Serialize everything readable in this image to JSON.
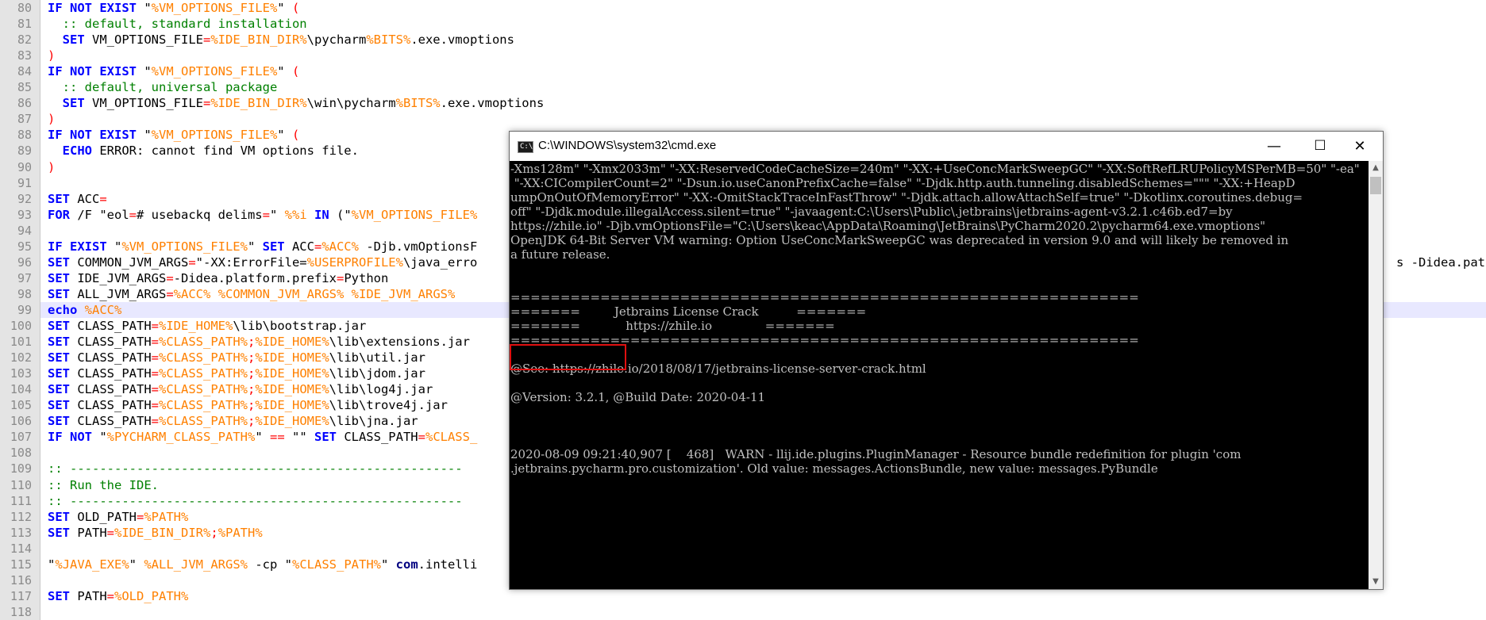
{
  "editor": {
    "line_numbers": [
      "80",
      "81",
      "82",
      "83",
      "84",
      "85",
      "86",
      "87",
      "88",
      "89",
      "90",
      "91",
      "92",
      "93",
      "94",
      "95",
      "96",
      "97",
      "98",
      "99",
      "100",
      "101",
      "102",
      "103",
      "104",
      "105",
      "106",
      "107",
      "108",
      "109",
      "110",
      "111",
      "112",
      "113",
      "114",
      "115",
      "116",
      "117",
      "118"
    ],
    "lines": {
      "l80": [
        "IF NOT EXIST",
        " \"",
        "%VM_OPTIONS_FILE%",
        "\" ",
        "("
      ],
      "l81": "  :: default, standard installation",
      "l82": [
        "  ",
        "SET",
        " VM_OPTIONS_FILE",
        "=",
        "%IDE_BIN_DIR%",
        "\\pycharm",
        "%BITS%",
        ".exe.vmoptions"
      ],
      "l83": ")",
      "l84": [
        "IF NOT EXIST",
        " \"",
        "%VM_OPTIONS_FILE%",
        "\" ",
        "("
      ],
      "l85": "  :: default, universal package",
      "l86": [
        "  ",
        "SET",
        " VM_OPTIONS_FILE",
        "=",
        "%IDE_BIN_DIR%",
        "\\win\\pycharm",
        "%BITS%",
        ".exe.vmoptions"
      ],
      "l87": ")",
      "l88": [
        "IF NOT EXIST",
        " \"",
        "%VM_OPTIONS_FILE%",
        "\" ",
        "("
      ],
      "l89": [
        "  ",
        "ECHO",
        " ERROR: cannot find VM options file."
      ],
      "l90": ")",
      "l92": [
        "SET",
        " ACC",
        "="
      ],
      "l93": [
        "FOR",
        " /F \"eol",
        "=",
        "# usebackq delims",
        "=",
        "\" ",
        "%%i",
        " ",
        "IN",
        " (\"",
        "%VM_OPTIONS_FILE%"
      ],
      "l95": [
        "IF EXIST",
        " \"",
        "%VM_OPTIONS_FILE%",
        "\" ",
        "SET",
        " ACC",
        "=",
        "%ACC%",
        " -Djb.vmOptionsF"
      ],
      "l96": [
        "SET",
        " COMMON_JVM_ARGS",
        "=",
        "\"-XX:ErrorFile=",
        "%USERPROFILE%",
        "\\java_erro"
      ],
      "l96_right": "s -Didea.paths",
      "l97": [
        "SET",
        " IDE_JVM_ARGS",
        "=",
        "-Didea.platform.prefix",
        "=",
        "Python"
      ],
      "l98": [
        "SET",
        " ALL_JVM_ARGS",
        "=",
        "%ACC%",
        " ",
        "%COMMON_JVM_ARGS%",
        " ",
        "%IDE_JVM_ARGS%"
      ],
      "l99": [
        "echo",
        " ",
        "%ACC%"
      ],
      "l100": [
        "SET",
        " CLASS_PATH",
        "=",
        "%IDE_HOME%",
        "\\lib\\bootstrap.jar"
      ],
      "l101": [
        "SET",
        " CLASS_PATH",
        "=",
        "%CLASS_PATH%",
        ";",
        "%IDE_HOME%",
        "\\lib\\extensions.jar"
      ],
      "l102": [
        "SET",
        " CLASS_PATH",
        "=",
        "%CLASS_PATH%",
        ";",
        "%IDE_HOME%",
        "\\lib\\util.jar"
      ],
      "l103": [
        "SET",
        " CLASS_PATH",
        "=",
        "%CLASS_PATH%",
        ";",
        "%IDE_HOME%",
        "\\lib\\jdom.jar"
      ],
      "l104": [
        "SET",
        " CLASS_PATH",
        "=",
        "%CLASS_PATH%",
        ";",
        "%IDE_HOME%",
        "\\lib\\log4j.jar"
      ],
      "l105": [
        "SET",
        " CLASS_PATH",
        "=",
        "%CLASS_PATH%",
        ";",
        "%IDE_HOME%",
        "\\lib\\trove4j.jar"
      ],
      "l106": [
        "SET",
        " CLASS_PATH",
        "=",
        "%CLASS_PATH%",
        ";",
        "%IDE_HOME%",
        "\\lib\\jna.jar"
      ],
      "l107": [
        "IF NOT",
        " \"",
        "%PYCHARM_CLASS_PATH%",
        "\" ",
        "==",
        " \"\" ",
        "SET",
        " CLASS_PATH",
        "=",
        "%CLASS_"
      ],
      "l109": ":: -----------------------------------------------------",
      "l110": ":: Run the IDE.",
      "l111": ":: -----------------------------------------------------",
      "l112": [
        "SET",
        " OLD_PATH",
        "=",
        "%PATH%"
      ],
      "l113": [
        "SET",
        " PATH",
        "=",
        "%IDE_BIN_DIR%",
        ";",
        "%PATH%"
      ],
      "l115": [
        "\"",
        "%JAVA_EXE%",
        "\" ",
        "%ALL_JVM_ARGS%",
        " -cp \"",
        "%CLASS_PATH%",
        "\" ",
        "com",
        ".intelli"
      ],
      "l117": [
        "SET",
        " PATH",
        "=",
        "%OLD_PATH%"
      ]
    }
  },
  "cmd_window": {
    "title": "C:\\WINDOWS\\system32\\cmd.exe",
    "icon": "cmd-prompt-icon",
    "icon_glyph": "C:\\",
    "minimize": "—",
    "maximize": "☐",
    "close": "✕",
    "scroll_up": "▲",
    "scroll_down": "▼",
    "output_lines": [
      "-Xms128m\" \"-Xmx2033m\" \"-XX:ReservedCodeCacheSize=240m\" \"-XX:+UseConcMarkSweepGC\" \"-XX:SoftRefLRUPolicyMSPerMB=50\" \"-ea\"",
      " \"-XX:CICompilerCount=2\" \"-Dsun.io.useCanonPrefixCache=false\" \"-Djdk.http.auth.tunneling.disabledSchemes=\"\"\" \"-XX:+HeapD",
      "umpOnOutOfMemoryError\" \"-XX:-OmitStackTraceInFastThrow\" \"-Djdk.attach.allowAttachSelf=true\" \"-Dkotlinx.coroutines.debug=",
      "off\" \"-Djdk.module.illegalAccess.silent=true\" \"-javaagent:C:\\Users\\Public\\.jetbrains\\jetbrains-agent-v3.2.1.c46b.ed7=by",
      "https://zhile.io\" -Djb.vmOptionsFile=\"C:\\Users\\keac\\AppData\\Roaming\\JetBrains\\PyCharm2020.2\\pycharm64.exe.vmoptions\"",
      "OpenJDK 64-Bit Server VM warning: Option UseConcMarkSweepGC was deprecated in version 9.0 and will likely be removed in",
      "a future release.",
      "",
      "",
      "===============================================================",
      "=======         Jetbrains License Crack          =======",
      "=======            https://zhile.io              =======",
      "===============================================================",
      "",
      "@See: https://zhile.io/2018/08/17/jetbrains-license-server-crack.html",
      "",
      "@Version: 3.2.1, @Build Date: 2020-04-11",
      "",
      "",
      "",
      "2020-08-09 09:21:40,907 [    468]   WARN - llij.ide.plugins.PluginManager - Resource bundle redefinition for plugin 'com",
      ".jetbrains.pycharm.pro.customization'. Old value: messages.ActionsBundle, new value: messages.PyBundle"
    ]
  },
  "colors": {
    "keyword": "#0000ff",
    "variable": "#ff8000",
    "comment": "#008000",
    "operator": "#ff0000",
    "gutter_bg": "#e4e4e4",
    "console_bg": "#000000",
    "console_text": "#c0c0c0",
    "highlight_box": "#e01010"
  }
}
